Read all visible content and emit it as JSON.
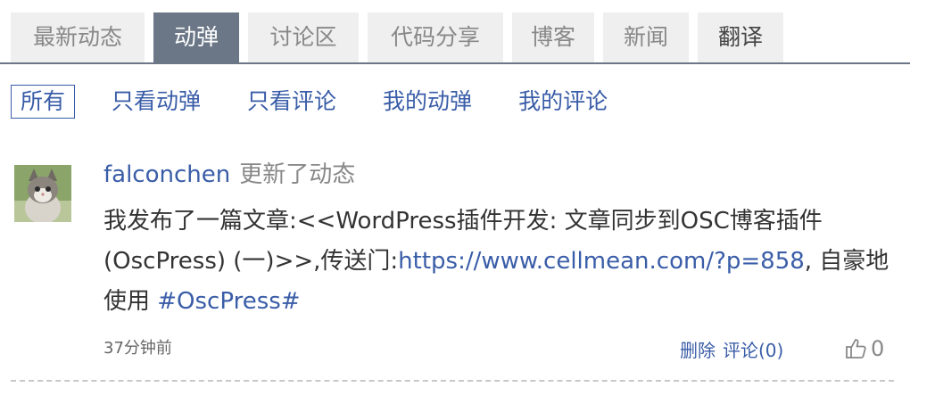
{
  "tabs": [
    {
      "label": "最新动态",
      "active": false
    },
    {
      "label": "动弹",
      "active": true
    },
    {
      "label": "讨论区",
      "active": false
    },
    {
      "label": "代码分享",
      "active": false
    },
    {
      "label": "博客",
      "active": false
    },
    {
      "label": "新闻",
      "active": false
    },
    {
      "label": "翻译",
      "active": false
    }
  ],
  "filters": [
    {
      "label": "所有",
      "active": true
    },
    {
      "label": "只看动弹",
      "active": false
    },
    {
      "label": "只看评论",
      "active": false
    },
    {
      "label": "我的动弹",
      "active": false
    },
    {
      "label": "我的评论",
      "active": false
    }
  ],
  "post": {
    "author": "falconchen",
    "action": "更新了动态",
    "text_before_link": "我发布了一篇文章:<<WordPress插件开发: 文章同步到OSC博客插件(OscPress) (一)>>,传送门:",
    "link": "https://www.cellmean.com/?p=858",
    "text_after_link": ", 自豪地使用 ",
    "hashtag": "#OscPress#",
    "time": "37分钟前",
    "delete_label": "删除",
    "comment_label": "评论(0)",
    "like_count": "0",
    "avatar_icon": "kitten-photo",
    "like_icon": "thumbs-up-icon"
  },
  "colors": {
    "accent": "#3a5da8",
    "tab_active_bg": "#6b7787",
    "tab_bg": "#efefef"
  }
}
